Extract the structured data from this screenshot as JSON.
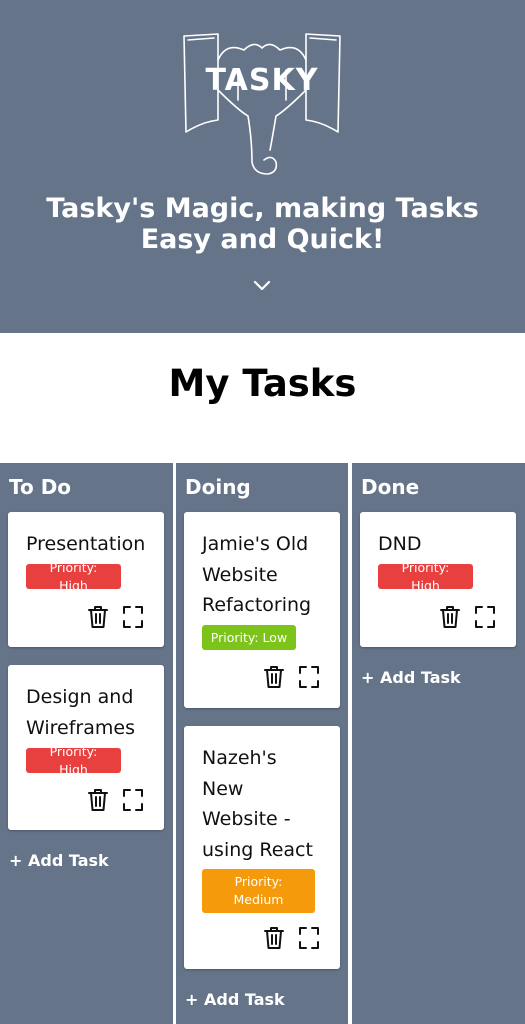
{
  "hero": {
    "logo_text": "TASKY",
    "title_line1": "Tasky's Magic, making Tasks",
    "title_line2": "Easy and Quick!"
  },
  "page_title": "My Tasks",
  "colors": {
    "header_bg": "#657489",
    "column_bg": "#657489",
    "priority_high": "#e8403f",
    "priority_low": "#7cc41a",
    "priority_medium": "#f59a0b"
  },
  "columns": [
    {
      "title": "To Do",
      "add_label": "+ Add Task",
      "cards": [
        {
          "title_lines": [
            "Presentation"
          ],
          "priority": "Priority: High"
        },
        {
          "title_lines": [
            "Design and",
            "Wireframes"
          ],
          "priority": "Priority: High"
        }
      ]
    },
    {
      "title": "Doing",
      "add_label": "+ Add Task",
      "cards": [
        {
          "title_lines": [
            "Jamie's Old",
            "Website",
            "Refactoring"
          ],
          "priority": "Priority: Low"
        },
        {
          "title_lines": [
            "Nazeh's",
            "New",
            "Website -",
            "using React"
          ],
          "priority_lines": [
            "Priority:",
            "Medium"
          ]
        }
      ]
    },
    {
      "title": "Done",
      "add_label": "+ Add Task",
      "cards": [
        {
          "title_lines": [
            "DND"
          ],
          "priority": "Priority: High"
        }
      ]
    }
  ],
  "icons": {
    "delete": "trash-icon",
    "expand": "expand-icon",
    "scroll": "chevron-down-icon"
  }
}
